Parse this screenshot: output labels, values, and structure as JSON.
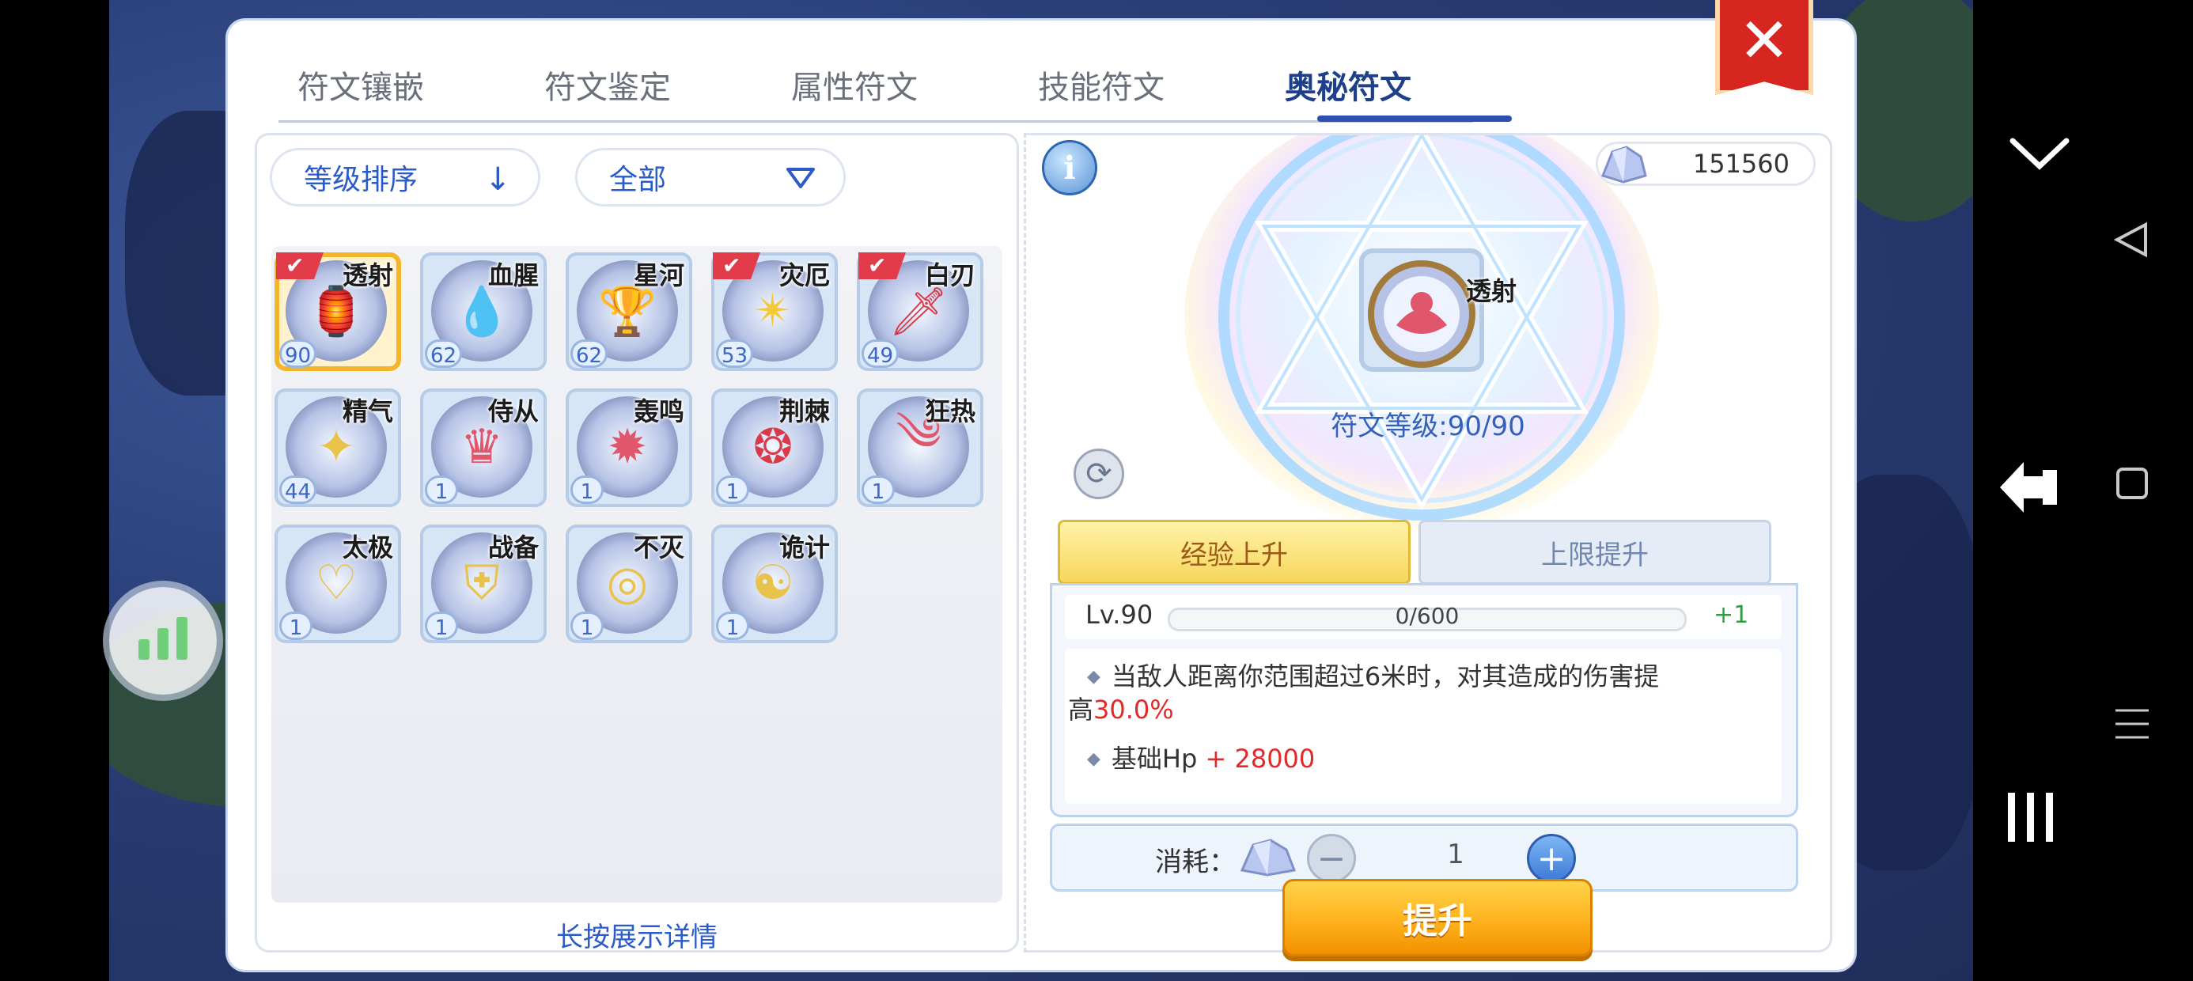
{
  "tabs": [
    "符文镶嵌",
    "符文鉴定",
    "属性符文",
    "技能符文",
    "奥秘符文"
  ],
  "active_tab_index": 4,
  "filters": {
    "sort_label": "等级排序",
    "sort_icon": "down-arrow-icon",
    "category_label": "全部",
    "category_icon": "triangle-dropdown-icon"
  },
  "runes": [
    {
      "name": "透射",
      "level": "90",
      "equipped": true,
      "selected": true,
      "emblem": "lamp"
    },
    {
      "name": "血腥",
      "level": "62",
      "equipped": false,
      "selected": false,
      "emblem": "blood-drop"
    },
    {
      "name": "星河",
      "level": "62",
      "equipped": false,
      "selected": false,
      "emblem": "trophy"
    },
    {
      "name": "灾厄",
      "level": "53",
      "equipped": true,
      "selected": false,
      "emblem": "burst"
    },
    {
      "name": "白刃",
      "level": "49",
      "equipped": true,
      "selected": false,
      "emblem": "sword"
    },
    {
      "name": "精气",
      "level": "44",
      "equipped": false,
      "selected": false,
      "emblem": "sparkle"
    },
    {
      "name": "侍从",
      "level": "1",
      "equipped": false,
      "selected": false,
      "emblem": "crown"
    },
    {
      "name": "轰鸣",
      "level": "1",
      "equipped": false,
      "selected": false,
      "emblem": "blast"
    },
    {
      "name": "荆棘",
      "level": "1",
      "equipped": false,
      "selected": false,
      "emblem": "thorn-ring"
    },
    {
      "name": "狂热",
      "level": "1",
      "equipped": false,
      "selected": false,
      "emblem": "spiral"
    },
    {
      "name": "太极",
      "level": "1",
      "equipped": false,
      "selected": false,
      "emblem": "heart"
    },
    {
      "name": "战备",
      "level": "1",
      "equipped": false,
      "selected": false,
      "emblem": "shield"
    },
    {
      "name": "不灭",
      "level": "1",
      "equipped": false,
      "selected": false,
      "emblem": "halo"
    },
    {
      "name": "诡计",
      "level": "1",
      "equipped": false,
      "selected": false,
      "emblem": "mask"
    }
  ],
  "hint": "长按展示详情",
  "detail": {
    "currency_amount": "151560",
    "rune_name": "透射",
    "rune_level_text": "符文等级:90/90",
    "subtab_exp": "经验上升",
    "subtab_cap": "上限提升",
    "level_label": "Lv.90",
    "exp_text": "0/600",
    "exp_progress": 0,
    "level_plus": "+1",
    "desc_line1": "当敌人距离你范围超过6米时，对其造成的伤害提",
    "desc_line2_prefix": "高",
    "desc_line2_value": "30.0%",
    "desc_hp_label": "基础Hp",
    "desc_hp_value": " + 28000",
    "consume_label": "消耗：",
    "consume_qty": "1",
    "upgrade_label": "提升"
  },
  "colors": {
    "accent_blue": "#2a5bc8",
    "active_tab": "#1e3f8a",
    "close_red": "#d7261f",
    "upgrade_orange": "#ffb21e",
    "highlight_red": "#e02a2a"
  }
}
